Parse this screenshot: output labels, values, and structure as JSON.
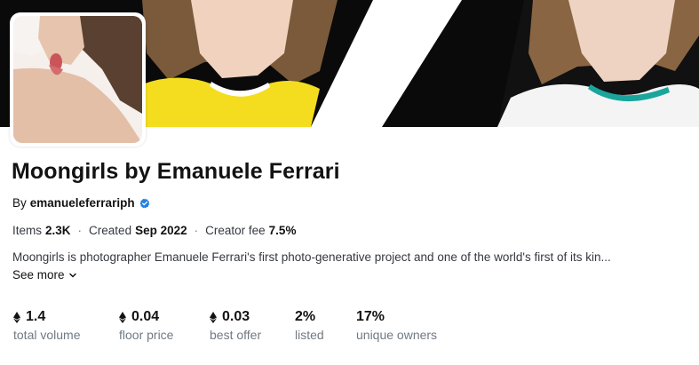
{
  "collection": {
    "title": "Moongirls by Emanuele Ferrari",
    "by_label": "By",
    "creator": "emanueleferrariph",
    "verified_icon": "verified-badge-icon",
    "accent_color": "#2081e2"
  },
  "meta": {
    "items_label": "Items",
    "items_value": "2.3K",
    "created_label": "Created",
    "created_value": "Sep 2022",
    "fee_label": "Creator fee",
    "fee_value": "7.5%",
    "separator": "·"
  },
  "description": {
    "text": "Moongirls is photographer Emanuele Ferrari's first photo-generative project and one of the world's first of its kin...",
    "see_more_label": "See more",
    "see_more_icon": "chevron-down-icon"
  },
  "stats": [
    {
      "value": "1.4",
      "label": "total volume",
      "icon": "ethereum-icon"
    },
    {
      "value": "0.04",
      "label": "floor price",
      "icon": "ethereum-icon"
    },
    {
      "value": "0.03",
      "label": "best offer",
      "icon": "ethereum-icon"
    },
    {
      "value": "2%",
      "label": "listed"
    },
    {
      "value": "17%",
      "label": "unique owners"
    }
  ]
}
